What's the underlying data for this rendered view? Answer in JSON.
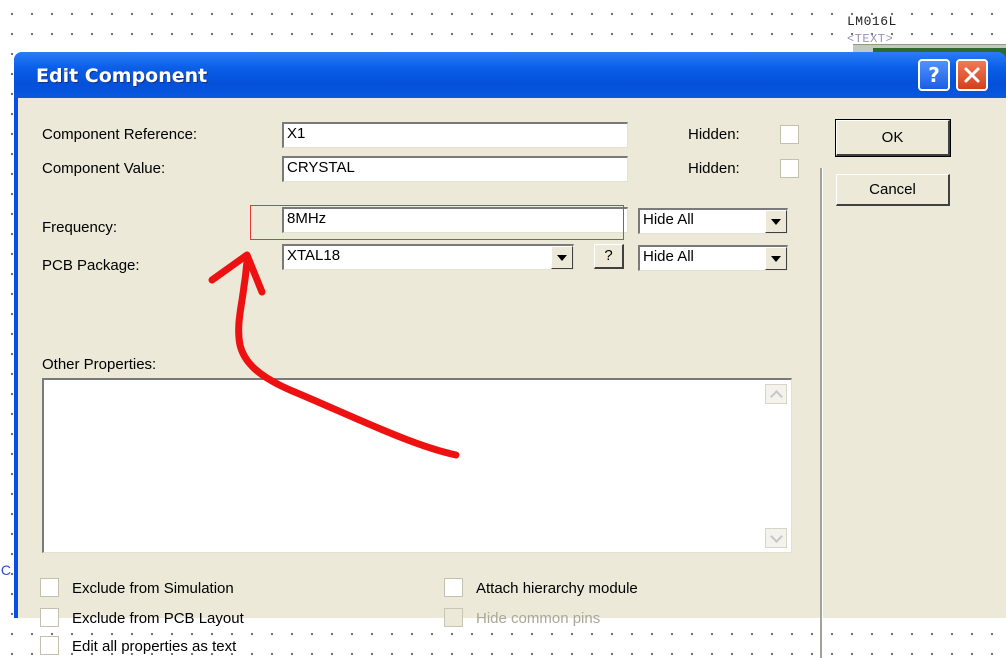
{
  "background": {
    "component_label": "LM016L",
    "text_label": "<TEXT>",
    "side_glyph": "IC"
  },
  "dialog": {
    "title": "Edit Component",
    "help_icon": "?",
    "fields": {
      "component_reference": {
        "label": "Component Reference:",
        "value": "X1",
        "hidden_label": "Hidden:"
      },
      "component_value": {
        "label": "Component Value:",
        "value": "CRYSTAL",
        "hidden_label": "Hidden:"
      },
      "frequency": {
        "label": "Frequency:",
        "value": "8MHz",
        "visibility": "Hide All"
      },
      "pcb_package": {
        "label": "PCB Package:",
        "value": "XTAL18",
        "help_label": "?",
        "visibility": "Hide All"
      },
      "other_properties": {
        "label": "Other Properties:",
        "value": ""
      }
    },
    "checkboxes": {
      "exclude_simulation": "Exclude from Simulation",
      "exclude_pcb": "Exclude from PCB Layout",
      "edit_all": "Edit all properties as text",
      "attach_hierarchy": "Attach hierarchy module",
      "hide_common_pins": "Hide common pins"
    },
    "buttons": {
      "ok": "OK",
      "cancel": "Cancel"
    }
  },
  "annotation": {
    "color": "#ee1111",
    "highlight_color": "#e23a3a",
    "target": "frequency-field"
  }
}
